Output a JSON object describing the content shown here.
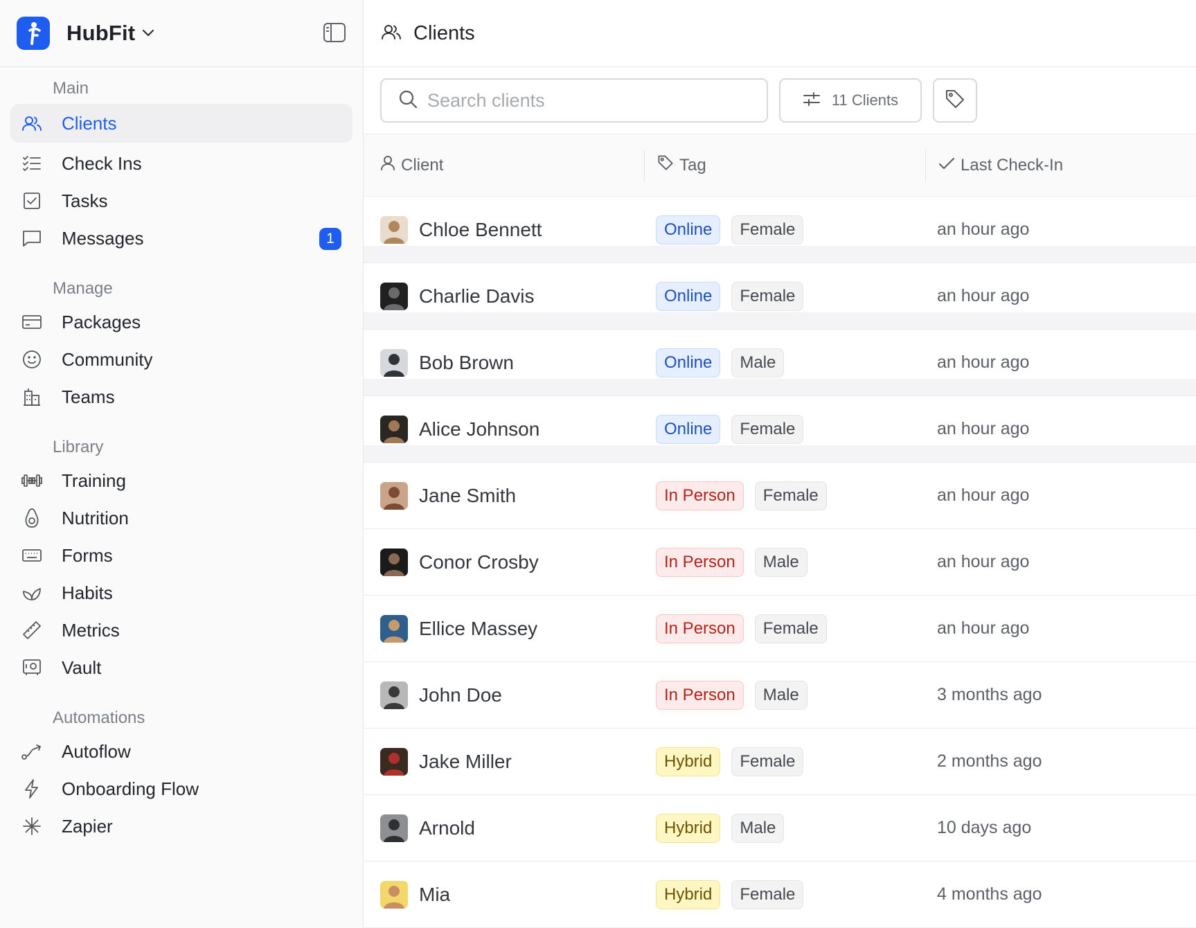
{
  "app": {
    "name": "HubFit"
  },
  "sidebar": {
    "sections": [
      {
        "label": "Main",
        "items": [
          {
            "label": "Clients",
            "icon": "users-icon",
            "active": true
          },
          {
            "label": "Check Ins",
            "icon": "checklist-icon"
          },
          {
            "label": "Tasks",
            "icon": "checkbox-icon"
          },
          {
            "label": "Messages",
            "icon": "message-icon",
            "badge": "1"
          }
        ]
      },
      {
        "label": "Manage",
        "items": [
          {
            "label": "Packages",
            "icon": "card-icon"
          },
          {
            "label": "Community",
            "icon": "smile-icon"
          },
          {
            "label": "Teams",
            "icon": "building-icon"
          }
        ]
      },
      {
        "label": "Library",
        "items": [
          {
            "label": "Training",
            "icon": "dumbbell-icon"
          },
          {
            "label": "Nutrition",
            "icon": "avocado-icon"
          },
          {
            "label": "Forms",
            "icon": "keyboard-icon"
          },
          {
            "label": "Habits",
            "icon": "sprout-icon"
          },
          {
            "label": "Metrics",
            "icon": "ruler-icon"
          },
          {
            "label": "Vault",
            "icon": "safe-icon"
          }
        ]
      },
      {
        "label": "Automations",
        "items": [
          {
            "label": "Autoflow",
            "icon": "route-icon"
          },
          {
            "label": "Onboarding Flow",
            "icon": "zap-icon"
          },
          {
            "label": "Zapier",
            "icon": "asterisk-icon"
          }
        ]
      }
    ]
  },
  "header": {
    "title": "Clients"
  },
  "toolbar": {
    "search_placeholder": "Search clients",
    "clients_count_label": "11 Clients"
  },
  "table": {
    "columns": [
      "Client",
      "Tag",
      "Last Check-In"
    ],
    "rows": [
      {
        "name": "Chloe Bennett",
        "mode": "Online",
        "gender": "Female",
        "last": "an hour ago",
        "avatar": [
          "#e9dccc",
          "#b0865c"
        ]
      },
      {
        "name": "Charlie Davis",
        "mode": "Online",
        "gender": "Female",
        "last": "an hour ago",
        "avatar": [
          "#202020",
          "#6b6b6b"
        ]
      },
      {
        "name": "Bob Brown",
        "mode": "Online",
        "gender": "Male",
        "last": "an hour ago",
        "avatar": [
          "#d6d8dc",
          "#30343b"
        ]
      },
      {
        "name": "Alice Johnson",
        "mode": "Online",
        "gender": "Female",
        "last": "an hour ago",
        "avatar": [
          "#2a2622",
          "#a27955"
        ]
      },
      {
        "name": "Jane Smith",
        "mode": "In Person",
        "gender": "Female",
        "last": "an hour ago",
        "avatar": [
          "#c9a48a",
          "#7c4b34"
        ]
      },
      {
        "name": "Conor Crosby",
        "mode": "In Person",
        "gender": "Male",
        "last": "an hour ago",
        "avatar": [
          "#1b1b1b",
          "#8a6a57"
        ]
      },
      {
        "name": "Ellice Massey",
        "mode": "In Person",
        "gender": "Female",
        "last": "an hour ago",
        "avatar": [
          "#2f5f8c",
          "#c79a6e"
        ]
      },
      {
        "name": "John Doe",
        "mode": "In Person",
        "gender": "Male",
        "last": "3 months ago",
        "avatar": [
          "#b8b8b8",
          "#3a3a3a"
        ]
      },
      {
        "name": "Jake Miller",
        "mode": "Hybrid",
        "gender": "Female",
        "last": "2 months ago",
        "avatar": [
          "#3b2a20",
          "#b0302c"
        ]
      },
      {
        "name": "Arnold",
        "mode": "Hybrid",
        "gender": "Male",
        "last": "10 days ago",
        "avatar": [
          "#8d8f92",
          "#2e3034"
        ]
      },
      {
        "name": "Mia",
        "mode": "Hybrid",
        "gender": "Female",
        "last": "4 months ago",
        "avatar": [
          "#f2d76a",
          "#c98f62"
        ]
      }
    ]
  },
  "colors": {
    "accent": "#1f5cf0",
    "online_bg": "#e5efff",
    "inperson_bg": "#fdeaea",
    "hybrid_bg": "#fef7c3"
  }
}
